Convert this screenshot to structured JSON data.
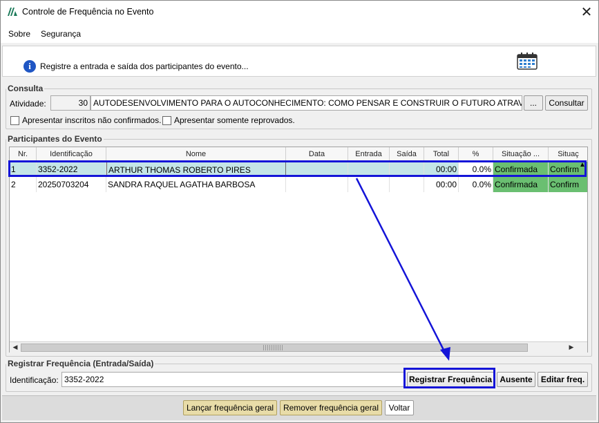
{
  "window": {
    "title": "Controle de Frequência no Evento"
  },
  "menu": {
    "items": [
      "Sobre",
      "Segurança"
    ]
  },
  "banner": {
    "text": "Registre a entrada e saída dos participantes do evento..."
  },
  "consulta": {
    "legend": "Consulta",
    "atividade_label": "Atividade:",
    "atividade_code": "30",
    "atividade_desc": "AUTODESENVOLVIMENTO PARA O AUTOCONHECIMENTO: COMO PENSAR E CONSTRUIR O FUTURO ATRAVÉS DE NO",
    "browse_label": "...",
    "consultar_label": "Consultar",
    "chk_nao_confirmados": "Apresentar inscritos não confirmados.",
    "chk_reprovados": "Apresentar somente reprovados."
  },
  "participantes": {
    "legend": "Participantes do Evento",
    "columns": [
      "Nr.",
      "Identificação",
      "Nome",
      "Data",
      "Entrada",
      "Saída",
      "Total",
      "%",
      "Situação ...",
      "Situaç"
    ],
    "rows": [
      {
        "nr": "1",
        "id": "3352-2022",
        "nome": "ARTHUR THOMAS ROBERTO PIRES",
        "data": "",
        "entrada": "",
        "saida": "",
        "total": "00:00",
        "pct": "0.0%",
        "situacao": "Confirmada",
        "situacao2": "Confirm"
      },
      {
        "nr": "2",
        "id": "20250703204",
        "nome": "SANDRA RAQUEL AGATHA BARBOSA",
        "data": "",
        "entrada": "",
        "saida": "",
        "total": "00:00",
        "pct": "0.0%",
        "situacao": "Confirmada",
        "situacao2": "Confirm"
      }
    ]
  },
  "registrar": {
    "legend": "Registrar Frequência (Entrada/Saída)",
    "id_label": "Identificação:",
    "id_value": "3352-2022",
    "btn_registrar": "Registrar Frequência",
    "btn_ausente": "Ausente",
    "btn_editar": "Editar freq."
  },
  "footer": {
    "btn_lancar": "Lançar frequência geral",
    "btn_remover": "Remover frequência geral",
    "btn_voltar": "Voltar"
  },
  "colors": {
    "selection": "#c4e5e7",
    "status_green": "#6abf71",
    "highlight": "#1414d8"
  }
}
